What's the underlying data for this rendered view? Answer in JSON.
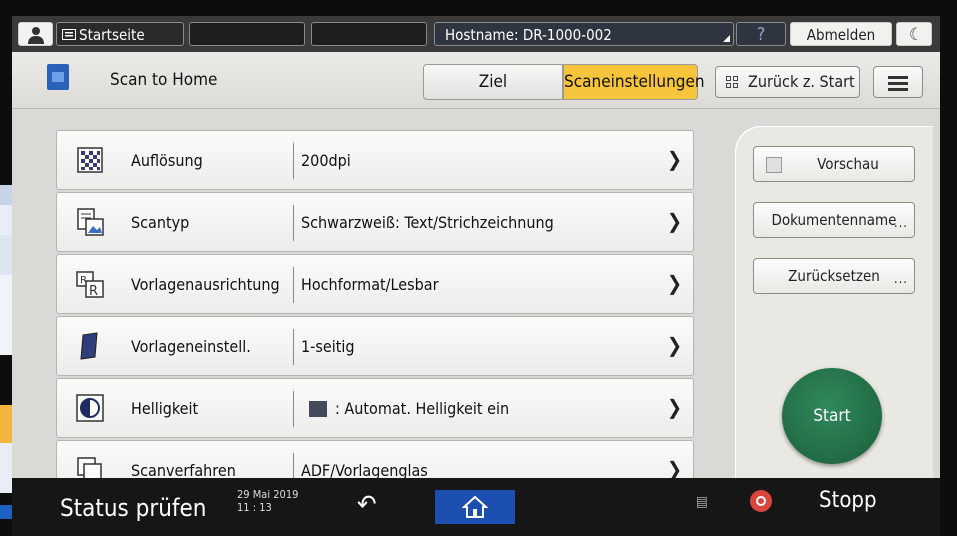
{
  "topbar": {
    "home_label": "Startseite",
    "hostname": "Hostname: DR-1000-002",
    "help": "?",
    "logout": "Abmelden",
    "moon": "☾"
  },
  "header": {
    "app_title": "Scan to Home",
    "tabs": [
      {
        "label": "Ziel",
        "active": false
      },
      {
        "label": "Scaneinstellungen",
        "active": true
      }
    ],
    "back_label": "Zurück z. Start",
    "menu_icon": "hamburger-icon"
  },
  "settings": [
    {
      "icon": "resolution-icon",
      "label": "Auflösung",
      "value": "200dpi"
    },
    {
      "icon": "scan-type-icon",
      "label": "Scantyp",
      "value": "Schwarzweiß: Text/Strichzeichnung"
    },
    {
      "icon": "orientation-icon",
      "label": "Vorlagenausrichtung",
      "value": "Hochformat/Lesbar"
    },
    {
      "icon": "original-setting-icon",
      "label": "Vorlageneinstell.",
      "value": "1-seitig"
    },
    {
      "icon": "brightness-icon",
      "label": "Helligkeit",
      "value": ": Automat. Helligkeit ein"
    },
    {
      "icon": "scan-method-icon",
      "label": "Scanverfahren",
      "value": "ADF/Vorlagenglas"
    }
  ],
  "side_panel": {
    "preview": "Vorschau",
    "document_name": "Dokumentenname",
    "reset": "Zurücksetzen",
    "start": "Start"
  },
  "bottombar": {
    "status": "Status prüfen",
    "date": "29 Mai 2019",
    "time": "11 : 13",
    "stop": "Stopp"
  },
  "colors": {
    "accent_tab": "#f7c53b",
    "start_button": "#1f6b45",
    "home_button": "#1d4fb0",
    "stop_icon": "#d9463b"
  }
}
